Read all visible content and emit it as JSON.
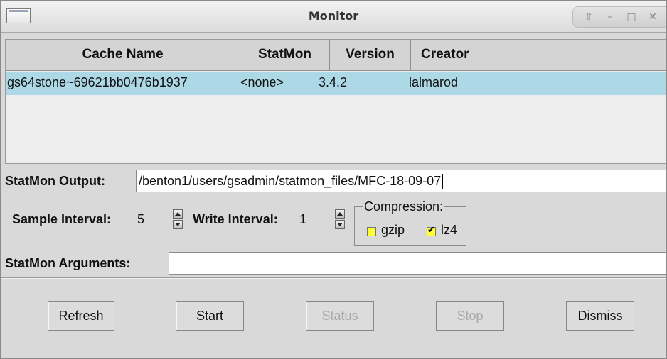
{
  "window": {
    "title": "Monitor",
    "controls": [
      "up-arrow-icon",
      "minimize-icon",
      "maximize-icon",
      "close-icon"
    ]
  },
  "table": {
    "columns": [
      "Cache Name",
      "StatMon",
      "Version",
      "Creator"
    ],
    "rows": [
      {
        "cache_name": "gs64stone~69621bb0476b1937",
        "statmon": "<none>",
        "version": "3.4.2",
        "creator": "lalmarod"
      }
    ],
    "selected_row_color": "#add8e6"
  },
  "statmon_output": {
    "label": "StatMon Output:",
    "value": "/benton1/users/gsadmin/statmon_files/MFC-18-09-07"
  },
  "sample_interval": {
    "label": "Sample Interval:",
    "value": "5"
  },
  "write_interval": {
    "label": "Write Interval:",
    "value": "1"
  },
  "compression": {
    "title": "Compression:",
    "options": [
      {
        "label": "gzip",
        "checked": false
      },
      {
        "label": "lz4",
        "checked": true
      }
    ]
  },
  "statmon_arguments": {
    "label": "StatMon Arguments:",
    "value": ""
  },
  "buttons": {
    "refresh": {
      "label": "Refresh",
      "enabled": true
    },
    "start": {
      "label": "Start",
      "enabled": true
    },
    "status": {
      "label": "Status",
      "enabled": false
    },
    "stop": {
      "label": "Stop",
      "enabled": false
    },
    "dismiss": {
      "label": "Dismiss",
      "enabled": true
    }
  }
}
